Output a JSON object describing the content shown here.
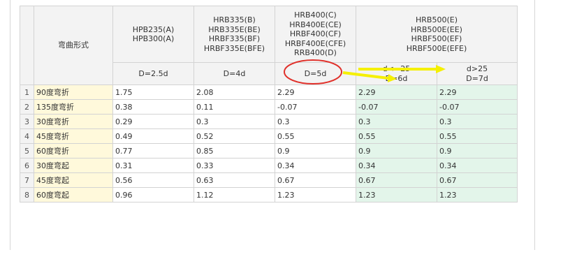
{
  "table": {
    "header": {
      "bend_form": "弯曲形式",
      "groups": [
        {
          "lines": [
            "HPB235(A)",
            "HPB300(A)"
          ]
        },
        {
          "lines": [
            "HRB335(B)",
            "HRB335E(BE)",
            "HRBF335(BF)",
            "HRBF335E(BFE)"
          ]
        },
        {
          "lines": [
            "HRB400(C)",
            "HRB400E(CE)",
            "HRBF400(CF)",
            "HRBF400E(CFE)",
            "RRB400(D)"
          ]
        },
        {
          "lines": [
            "HRB500(E)",
            "HRB500E(EE)",
            "HRBF500(EF)",
            "HRBF500E(EFE)"
          ]
        }
      ],
      "sub": {
        "c1": "D=2.5d",
        "c2": "D=4d",
        "c3": "D=5d",
        "c4_top": "d<=25",
        "c4_bottom": "D=6d",
        "c5_top": "d>25",
        "c5_bottom": "D=7d"
      }
    },
    "rows": [
      {
        "num": "1",
        "name": "90度弯折",
        "v1": "1.75",
        "v2": "2.08",
        "v3": "2.29",
        "v4": "2.29",
        "v5": "2.29"
      },
      {
        "num": "2",
        "name": "135度弯折",
        "v1": "0.38",
        "v2": "0.11",
        "v3": "-0.07",
        "v4": "-0.07",
        "v5": "-0.07"
      },
      {
        "num": "3",
        "name": "30度弯折",
        "v1": "0.29",
        "v2": "0.3",
        "v3": "0.3",
        "v4": "0.3",
        "v5": "0.3"
      },
      {
        "num": "4",
        "name": "45度弯折",
        "v1": "0.49",
        "v2": "0.52",
        "v3": "0.55",
        "v4": "0.55",
        "v5": "0.55"
      },
      {
        "num": "5",
        "name": "60度弯折",
        "v1": "0.77",
        "v2": "0.85",
        "v3": "0.9",
        "v4": "0.9",
        "v5": "0.9"
      },
      {
        "num": "6",
        "name": "30度弯起",
        "v1": "0.31",
        "v2": "0.33",
        "v3": "0.34",
        "v4": "0.34",
        "v5": "0.34"
      },
      {
        "num": "7",
        "name": "45度弯起",
        "v1": "0.56",
        "v2": "0.63",
        "v3": "0.67",
        "v4": "0.67",
        "v5": "0.67"
      },
      {
        "num": "8",
        "name": "60度弯起",
        "v1": "0.96",
        "v2": "1.12",
        "v3": "1.23",
        "v4": "1.23",
        "v5": "1.23"
      }
    ]
  },
  "colors": {
    "highlight_circle": "#e0302a",
    "arrow": "#f5f000",
    "name_cell_bg": "#fff9db",
    "green_cell_bg": "#e3f5ea"
  }
}
